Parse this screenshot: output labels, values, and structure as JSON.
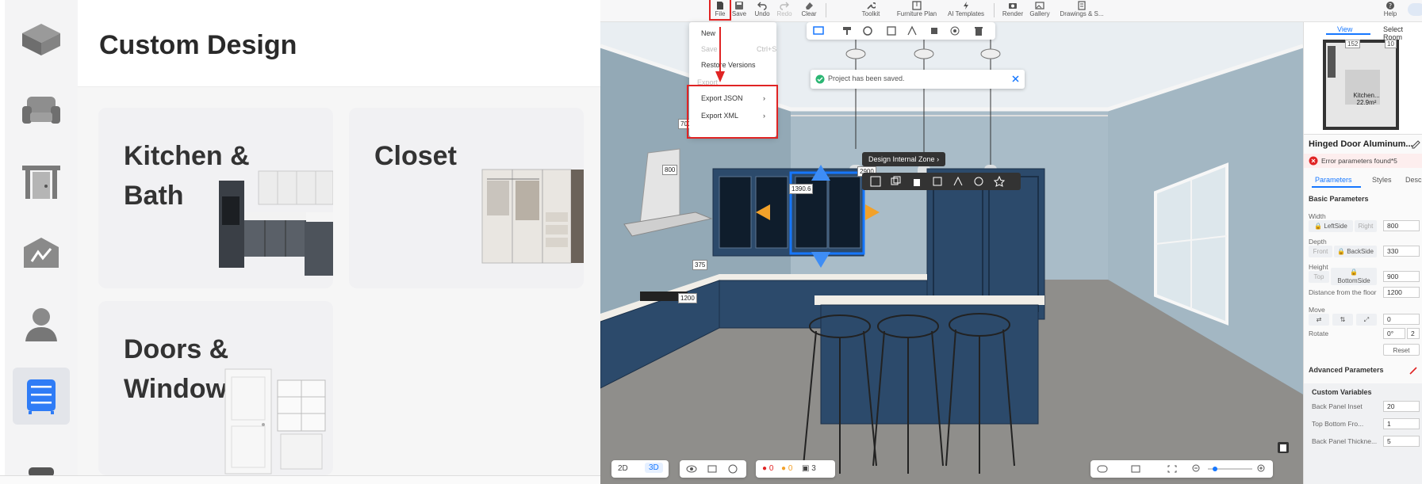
{
  "left_panel": {
    "title": "Custom Design",
    "rail_icons": [
      "cube-icon",
      "sofa-icon",
      "door-frame-icon",
      "wall-icon",
      "person-icon",
      "cabinet-icon",
      "partial-icon"
    ],
    "cards": [
      {
        "label": "Kitchen &\nBath"
      },
      {
        "label": "Closet"
      },
      {
        "label": "Doors &\nWindows"
      }
    ]
  },
  "toolbar": {
    "file": "File",
    "save": "Save",
    "undo": "Undo",
    "redo": "Redo",
    "clear": "Clear",
    "toolkit": "Toolkit",
    "furniture_plan": "Furniture Plan",
    "ai_templates": "AI Templates",
    "render": "Render",
    "gallery": "Gallery",
    "drawings": "Drawings & S...",
    "help": "Help"
  },
  "file_menu": {
    "new": "New",
    "save": "Save",
    "save_shortcut": "Ctrl+S",
    "restore": "Restore Versions",
    "export": "Export",
    "export_json": "Export JSON",
    "export_xml": "Export XML"
  },
  "toast": {
    "message": "Project has been saved."
  },
  "design_zone": {
    "label": "Design Internal Zone"
  },
  "dimensions": {
    "d700": "700",
    "d800": "800",
    "d1390": "1390.6",
    "d2900": "2900",
    "d375": "375",
    "d1200": "1200"
  },
  "minimap": {
    "tab_view": "View",
    "tab_select": "Select Room",
    "room_label": "Kitchen...",
    "room_area": "22.9m²",
    "num_a": "152",
    "num_b": "10"
  },
  "props": {
    "title": "Hinged Door Aluminum...",
    "error": "Error parameters found*5",
    "tabs": [
      "Parameters",
      "Styles",
      "Desc"
    ],
    "basic_header": "Basic Parameters",
    "width_label": "Width",
    "width_left": "LeftSide",
    "width_right": "Right",
    "width_value": "800",
    "depth_label": "Depth",
    "depth_front": "Front",
    "depth_back": "BackSide",
    "depth_value": "330",
    "height_label": "Height",
    "height_top": "Top",
    "height_bottom": "BottomSide",
    "height_value": "900",
    "floor_label": "Distance from the floor",
    "floor_value": "1200",
    "move_label": "Move",
    "move_value": "0",
    "rotate_label": "Rotate",
    "rotate_value": "0°",
    "rotate_value2": "2",
    "reset": "Reset",
    "advanced_header": "Advanced Parameters",
    "custom_header": "Custom Variables",
    "back_panel_inset_label": "Back Panel Inset",
    "back_panel_inset_value": "20",
    "top_bottom_label": "Top Bottom Fro...",
    "top_bottom_value": "1",
    "back_panel_thick_label": "Back Panel Thickne...",
    "back_panel_thick_value": "5"
  },
  "bottombar": {
    "mode_2d": "2D",
    "mode_3d": "3D",
    "err_count": "0",
    "warn_count": "0",
    "layer_count": "3"
  },
  "colors": {
    "accent": "#1677ff",
    "error": "#e02424",
    "cabinet": "#2c4a6b",
    "wall": "#9fb3bf"
  }
}
